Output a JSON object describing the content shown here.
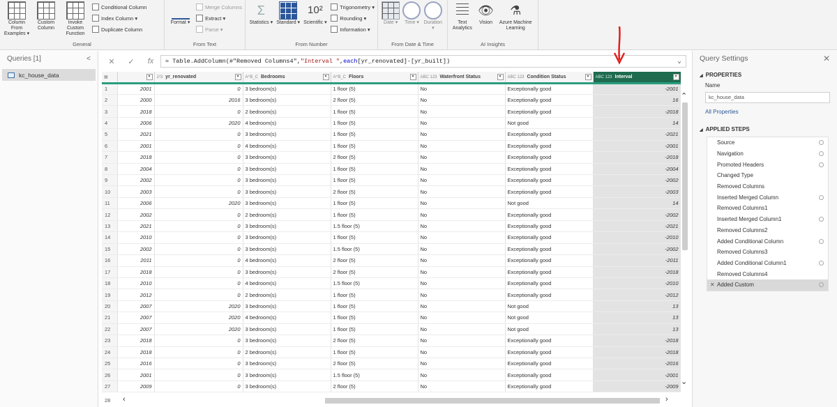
{
  "ribbon": {
    "general": {
      "label": "General",
      "buttons": [
        "Column From Examples ▾",
        "Custom Column",
        "Invoke Custom Function"
      ],
      "small": [
        "Conditional Column",
        "Index Column ▾",
        "Duplicate Column"
      ]
    },
    "from_text": {
      "label": "From Text",
      "format_label": "Format ▾",
      "small": [
        "Merge Columns",
        "Extract ▾",
        "Parse ▾"
      ]
    },
    "from_number": {
      "label": "From Number",
      "buttons": [
        "Statistics ▾",
        "Standard ▾",
        "Scientific ▾"
      ],
      "small": [
        "Trigonometry ▾",
        "Rounding ▾",
        "Information ▾"
      ]
    },
    "from_datetime": {
      "label": "From Date & Time",
      "buttons": [
        "Date ▾",
        "Time ▾",
        "Duration ▾"
      ]
    },
    "ai_insights": {
      "label": "AI Insights",
      "buttons": [
        "Text Analytics",
        "Vision",
        "Azure Machine Learning"
      ]
    }
  },
  "queries": {
    "header": "Queries [1]",
    "collapse": "<",
    "items": [
      "kc_house_data"
    ]
  },
  "formula": {
    "cancel": "✕",
    "confirm": "✓",
    "fx": "fx",
    "prefix": "= Table.AddColumn(#\"Removed Columns4\", ",
    "str": "\"Interval \"",
    "comma": ", ",
    "each": "each",
    "rest": " [yr_renovated]-[yr_built])",
    "expand": "⌄"
  },
  "grid": {
    "columns": [
      {
        "type": "",
        "name": ""
      },
      {
        "type": "1²3",
        "name": "yr_renovated"
      },
      {
        "type": "A^B_C",
        "name": "Bedrooms"
      },
      {
        "type": "A^B_C",
        "name": "Floors"
      },
      {
        "type": "ABC 123",
        "name": "Waterfront Status"
      },
      {
        "type": "ABC 123",
        "name": "Condition Status"
      },
      {
        "type": "ABC 123",
        "name": "Interval"
      }
    ],
    "rows": [
      [
        "2001",
        "0",
        "3 bedroom(s)",
        "1 floor (5)",
        "No",
        "Exceptionally good",
        "-2001"
      ],
      [
        "2000",
        "2016",
        "3 bedroom(s)",
        "2 floor (5)",
        "No",
        "Exceptionally good",
        "16"
      ],
      [
        "2018",
        "0",
        "2 bedroom(s)",
        "1 floor (5)",
        "No",
        "Exceptionally good",
        "-2018"
      ],
      [
        "2006",
        "2020",
        "4 bedroom(s)",
        "1 floor (5)",
        "No",
        "Not good",
        "14"
      ],
      [
        "2021",
        "0",
        "3 bedroom(s)",
        "1 floor (5)",
        "No",
        "Exceptionally good",
        "-2021"
      ],
      [
        "2001",
        "0",
        "4 bedroom(s)",
        "1 floor (5)",
        "No",
        "Exceptionally good",
        "-2001"
      ],
      [
        "2018",
        "0",
        "3 bedroom(s)",
        "2 floor (5)",
        "No",
        "Exceptionally good",
        "-2018"
      ],
      [
        "2004",
        "0",
        "3 bedroom(s)",
        "1 floor (5)",
        "No",
        "Exceptionally good",
        "-2004"
      ],
      [
        "2002",
        "0",
        "3 bedroom(s)",
        "1 floor (5)",
        "No",
        "Exceptionally good",
        "-2002"
      ],
      [
        "2003",
        "0",
        "3 bedroom(s)",
        "2 floor (5)",
        "No",
        "Exceptionally good",
        "-2003"
      ],
      [
        "2006",
        "2020",
        "3 bedroom(s)",
        "1 floor (5)",
        "No",
        "Not good",
        "14"
      ],
      [
        "2002",
        "0",
        "2 bedroom(s)",
        "1 floor (5)",
        "No",
        "Exceptionally good",
        "-2002"
      ],
      [
        "2021",
        "0",
        "3 bedroom(s)",
        "1.5 floor (5)",
        "No",
        "Exceptionally good",
        "-2021"
      ],
      [
        "2010",
        "0",
        "3 bedroom(s)",
        "1 floor (5)",
        "No",
        "Exceptionally good",
        "-2010"
      ],
      [
        "2002",
        "0",
        "3 bedroom(s)",
        "1.5 floor (5)",
        "No",
        "Exceptionally good",
        "-2002"
      ],
      [
        "2011",
        "0",
        "4 bedroom(s)",
        "2 floor (5)",
        "No",
        "Exceptionally good",
        "-2011"
      ],
      [
        "2018",
        "0",
        "3 bedroom(s)",
        "2 floor (5)",
        "No",
        "Exceptionally good",
        "-2018"
      ],
      [
        "2010",
        "0",
        "4 bedroom(s)",
        "1.5 floor (5)",
        "No",
        "Exceptionally good",
        "-2010"
      ],
      [
        "2012",
        "0",
        "2 bedroom(s)",
        "1 floor (5)",
        "No",
        "Exceptionally good",
        "-2012"
      ],
      [
        "2007",
        "2020",
        "3 bedroom(s)",
        "1 floor (5)",
        "No",
        "Not good",
        "13"
      ],
      [
        "2007",
        "2020",
        "4 bedroom(s)",
        "1 floor (5)",
        "No",
        "Not good",
        "13"
      ],
      [
        "2007",
        "2020",
        "3 bedroom(s)",
        "1 floor (5)",
        "No",
        "Not good",
        "13"
      ],
      [
        "2018",
        "0",
        "3 bedroom(s)",
        "2 floor (5)",
        "No",
        "Exceptionally good",
        "-2018"
      ],
      [
        "2018",
        "0",
        "2 bedroom(s)",
        "1 floor (5)",
        "No",
        "Exceptionally good",
        "-2018"
      ],
      [
        "2016",
        "0",
        "3 bedroom(s)",
        "2 floor (5)",
        "No",
        "Exceptionally good",
        "-2016"
      ],
      [
        "2001",
        "0",
        "3 bedroom(s)",
        "1.5 floor (5)",
        "No",
        "Exceptionally good",
        "-2001"
      ],
      [
        "2009",
        "0",
        "3 bedroom(s)",
        "2 floor (5)",
        "No",
        "Exceptionally good",
        "-2009"
      ]
    ],
    "last_row_index": "28"
  },
  "query_settings": {
    "title": "Query Settings",
    "close": "✕",
    "properties_label": "PROPERTIES",
    "name_label": "Name",
    "name_value": "kc_house_data",
    "all_properties": "All Properties",
    "applied_steps_label": "APPLIED STEPS",
    "steps": [
      {
        "name": "Source",
        "gear": true
      },
      {
        "name": "Navigation",
        "gear": true
      },
      {
        "name": "Promoted Headers",
        "gear": true
      },
      {
        "name": "Changed Type",
        "gear": false
      },
      {
        "name": "Removed Columns",
        "gear": false
      },
      {
        "name": "Inserted Merged Column",
        "gear": true
      },
      {
        "name": "Removed Columns1",
        "gear": false
      },
      {
        "name": "Inserted Merged Column1",
        "gear": true
      },
      {
        "name": "Removed Columns2",
        "gear": false
      },
      {
        "name": "Added Conditional Column",
        "gear": true
      },
      {
        "name": "Removed Columns3",
        "gear": false
      },
      {
        "name": "Added Conditional Column1",
        "gear": true
      },
      {
        "name": "Removed Columns4",
        "gear": false
      },
      {
        "name": "Added Custom",
        "gear": true,
        "active": true
      }
    ]
  },
  "colors": {
    "header_accent": "#2a9d7e",
    "selected_header": "#1e6b4f",
    "annotation_arrow": "#e02020"
  }
}
